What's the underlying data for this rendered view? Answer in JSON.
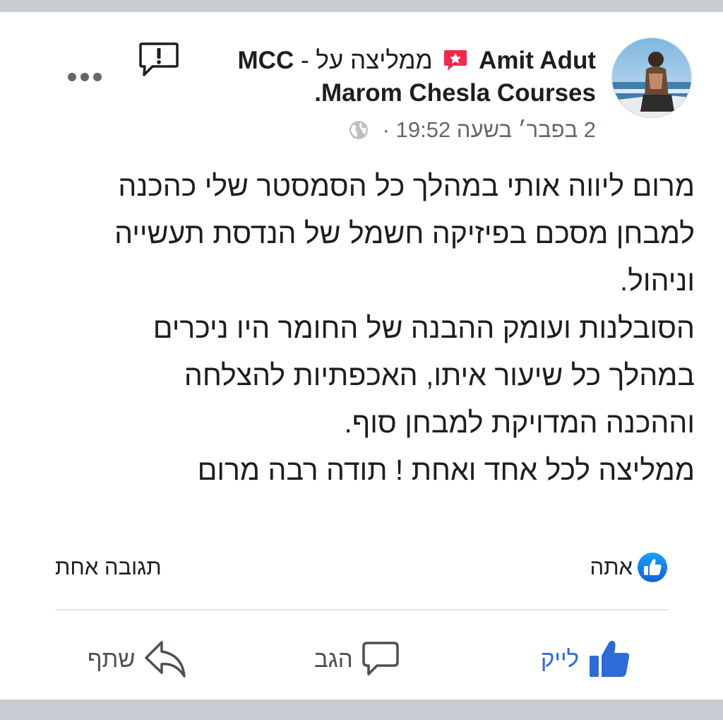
{
  "post": {
    "author_name": "Amit Adut",
    "recommends_text": "ממליצה על -",
    "page_name_short": "MCC",
    "page_name_full": "Marom Chesla Courses.",
    "timestamp": "2 בפבר׳ בשעה 19:52",
    "separator": "·",
    "body_lines": [
      "מרום ליווה אותי במהלך כל הסמסטר שלי כהכנה",
      "למבחן מסכם בפיזיקה חשמל של הנדסת תעשייה",
      "וניהול.",
      "הסובלנות ועומק ההבנה של החומר היו ניכרים",
      "במהלך כל שיעור איתו, האכפתיות להצלחה",
      "וההכנה המדויקת למבחן סוף.",
      "ממליצה לכל אחד ואחת ! תודה רבה מרום"
    ]
  },
  "reactions": {
    "label": "אתה"
  },
  "comments": {
    "count_label": "תגובה אחת"
  },
  "actions": {
    "like": "לייק",
    "comment": "הגב",
    "share": "שתף"
  },
  "colors": {
    "facebook_blue": "#2e6bd6",
    "recommend_red": "#f0284a",
    "band_gray": "#c9ccd3",
    "meta_gray": "#606770"
  },
  "icons": {
    "report": "report-exclamation-icon",
    "more": "more-dots-icon",
    "recommend": "recommend-star-icon",
    "privacy": "globe-icon",
    "like_badge": "like-badge-icon",
    "like": "thumbs-up-icon",
    "comment": "comment-bubble-icon",
    "share": "share-arrow-icon"
  }
}
